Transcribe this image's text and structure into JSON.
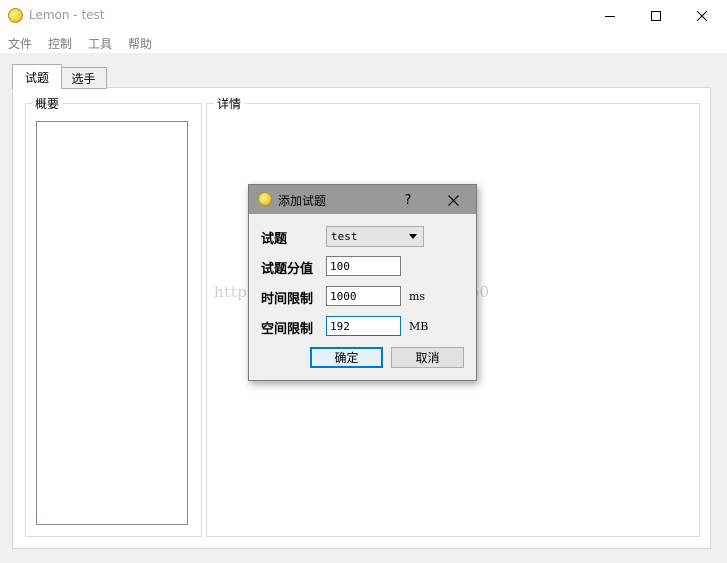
{
  "window": {
    "title": "Lemon - test",
    "minimize_icon": "minimize-icon",
    "maximize_icon": "maximize-icon",
    "close_icon": "close-icon"
  },
  "menu": [
    "文件",
    "控制",
    "工具",
    "帮助"
  ],
  "tabs": [
    {
      "label": "试题",
      "active": true
    },
    {
      "label": "选手",
      "active": false
    }
  ],
  "overview": {
    "title": "概要"
  },
  "details": {
    "title": "详情"
  },
  "watermark": "http://blog.csdn.net/0oLuoCheno0",
  "dialog": {
    "title": "添加试题",
    "help_label": "?",
    "problem_label": "试题",
    "problem_value": "test",
    "score_label": "试题分值",
    "score_value": "100",
    "time_label": "时间限制",
    "time_value": "1000",
    "time_unit": "ms",
    "space_label": "空间限制",
    "space_value": "192",
    "space_unit": "MB",
    "ok_label": "确定",
    "cancel_label": "取消"
  },
  "colors": {
    "accent": "#0078d7",
    "dialog_titlebar": "#999999",
    "background": "#f0f0f0"
  }
}
